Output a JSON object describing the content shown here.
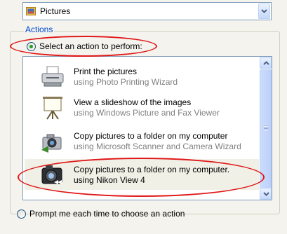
{
  "content_type": {
    "selected": "Pictures",
    "icon": "pictures-folder-icon"
  },
  "actions": {
    "legend": "Actions",
    "select_option": "Select an action to perform:",
    "prompt_option": "Prompt me each time to choose an action",
    "items": [
      {
        "title": "Print the pictures",
        "subtitle": "using Photo Printing Wizard",
        "icon": "printer-icon"
      },
      {
        "title": "View a slideshow of the images",
        "subtitle": "using Windows Picture and Fax Viewer",
        "icon": "projection-screen-icon"
      },
      {
        "title": "Copy pictures to a folder on my computer",
        "subtitle": "using Microsoft Scanner and Camera Wizard",
        "icon": "camera-wizard-icon"
      },
      {
        "title": "Copy pictures to a folder on my computer.",
        "subtitle": "using Nikon View 4",
        "icon": "nikon-camera-icon"
      }
    ]
  },
  "colors": {
    "legend": "#0046d5",
    "annotation": "#e01818",
    "radio_dot": "#21a121"
  }
}
